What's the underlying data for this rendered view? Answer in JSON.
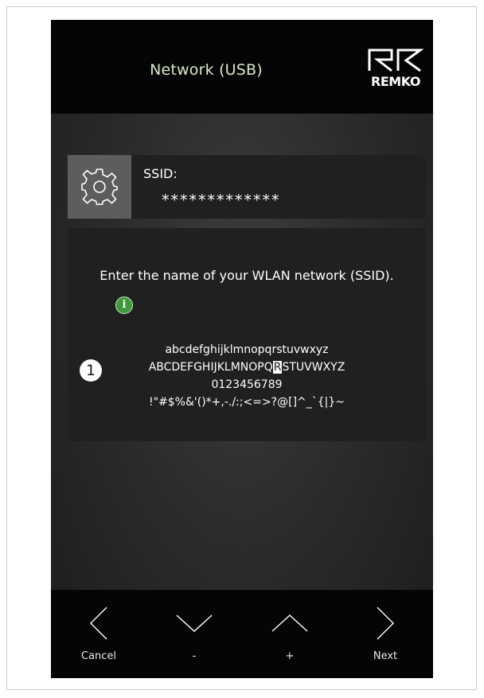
{
  "header": {
    "title": "Network (USB)",
    "logo_text": "REMKO"
  },
  "ssid": {
    "label": "SSID:",
    "value": "*************",
    "icon": "gear-icon"
  },
  "panel": {
    "instruction": "Enter the name of your WLAN network (SSID).",
    "info_icon_glyph": "i",
    "charset": {
      "lowercase": "abcdefghijklmnopqrstuvwxyz",
      "uppercase_before": "ABCDEFGHIJKLMNOPQ",
      "uppercase_selected": "R",
      "uppercase_after": "STUVWXYZ",
      "digits": "0123456789",
      "symbols": "!\"#$%&'()*+,-./:;<=>?@[]^_`{|}~"
    }
  },
  "callout": {
    "number": "1"
  },
  "footer": {
    "cancel": {
      "label": "Cancel",
      "icon": "chevron-left-icon"
    },
    "minus": {
      "label": "-",
      "icon": "chevron-down-icon"
    },
    "plus": {
      "label": "+",
      "icon": "chevron-up-icon"
    },
    "next": {
      "label": "Next",
      "icon": "chevron-right-icon"
    }
  },
  "colors": {
    "title": "#d8e8c8",
    "panel": "#202020",
    "gear_box": "#5d5d5d",
    "info": "#3f9a3a"
  }
}
